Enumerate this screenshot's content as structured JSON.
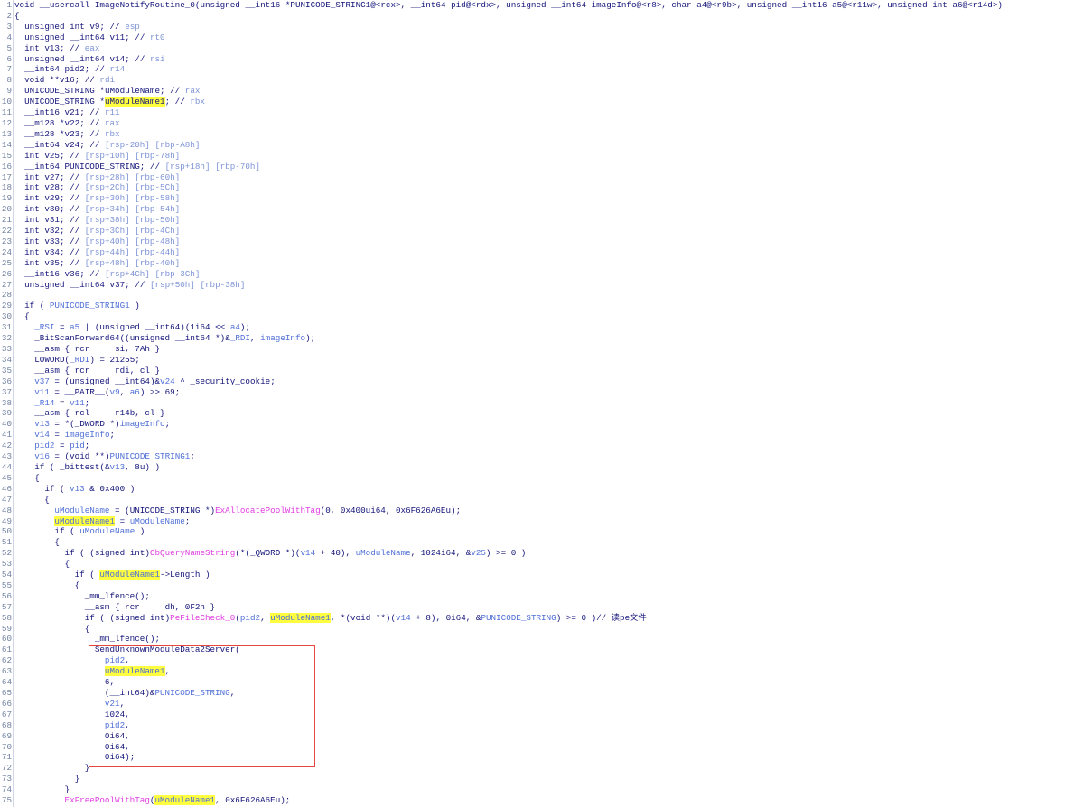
{
  "colors": {
    "background": "#ffffff",
    "code_text": "#14147a",
    "variable": "#4f6fd6",
    "api_function": "#e03ce0",
    "register_comment": "#7d93d6",
    "highlight": "#ffff40",
    "line_number": "#6f7f9f",
    "annotation_box": "#e5473d",
    "gutter_divider": "#cfd7e6"
  },
  "editor": {
    "highlighted_identifier": "uModuleName1",
    "lines": [
      {
        "n": 1,
        "text": "void __usercall ImageNotifyRoutine_0(unsigned __int16 *PUNICODE_STRING1@<rcx>, __int64 pid@<rdx>, unsigned __int64 imageInfo@<r8>, char a4@<r9b>, unsigned __int16 a5@<r11w>, unsigned int a6@<r14d>)"
      },
      {
        "n": 2,
        "text": "{"
      },
      {
        "n": 3,
        "text": "  unsigned int v9; // esp"
      },
      {
        "n": 4,
        "text": "  unsigned __int64 v11; // rt0"
      },
      {
        "n": 5,
        "text": "  int v13; // eax"
      },
      {
        "n": 6,
        "text": "  unsigned __int64 v14; // rsi"
      },
      {
        "n": 7,
        "text": "  __int64 pid2; // r14"
      },
      {
        "n": 8,
        "text": "  void **v16; // rdi"
      },
      {
        "n": 9,
        "text": "  UNICODE_STRING *uModuleName; // rax"
      },
      {
        "n": 10,
        "text": "  UNICODE_STRING *uModuleName1; // rbx"
      },
      {
        "n": 11,
        "text": "  __int16 v21; // r11"
      },
      {
        "n": 12,
        "text": "  __m128 *v22; // rax"
      },
      {
        "n": 13,
        "text": "  __m128 *v23; // rbx"
      },
      {
        "n": 14,
        "text": "  __int64 v24; // [rsp-20h] [rbp-A8h]"
      },
      {
        "n": 15,
        "text": "  int v25; // [rsp+10h] [rbp-78h]"
      },
      {
        "n": 16,
        "text": "  __int64 PUNICODE_STRING; // [rsp+18h] [rbp-70h]"
      },
      {
        "n": 17,
        "text": "  int v27; // [rsp+28h] [rbp-60h]"
      },
      {
        "n": 18,
        "text": "  int v28; // [rsp+2Ch] [rbp-5Ch]"
      },
      {
        "n": 19,
        "text": "  int v29; // [rsp+30h] [rbp-58h]"
      },
      {
        "n": 20,
        "text": "  int v30; // [rsp+34h] [rbp-54h]"
      },
      {
        "n": 21,
        "text": "  int v31; // [rsp+38h] [rbp-50h]"
      },
      {
        "n": 22,
        "text": "  int v32; // [rsp+3Ch] [rbp-4Ch]"
      },
      {
        "n": 23,
        "text": "  int v33; // [rsp+40h] [rbp-48h]"
      },
      {
        "n": 24,
        "text": "  int v34; // [rsp+44h] [rbp-44h]"
      },
      {
        "n": 25,
        "text": "  int v35; // [rsp+48h] [rbp-40h]"
      },
      {
        "n": 26,
        "text": "  __int16 v36; // [rsp+4Ch] [rbp-3Ch]"
      },
      {
        "n": 27,
        "text": "  unsigned __int64 v37; // [rsp+50h] [rbp-38h]"
      },
      {
        "n": 28,
        "text": ""
      },
      {
        "n": 29,
        "text": "  if ( PUNICODE_STRING1 )"
      },
      {
        "n": 30,
        "text": "  {"
      },
      {
        "n": 31,
        "text": "    _RSI = a5 | (unsigned __int64)(1i64 << a4);"
      },
      {
        "n": 32,
        "text": "    _BitScanForward64((unsigned __int64 *)&_RDI, imageInfo);"
      },
      {
        "n": 33,
        "text": "    __asm { rcr     si, 7Ah }"
      },
      {
        "n": 34,
        "text": "    LOWORD(_RDI) = 21255;"
      },
      {
        "n": 35,
        "text": "    __asm { rcr     rdi, cl }"
      },
      {
        "n": 36,
        "text": "    v37 = (unsigned __int64)&v24 ^ _security_cookie;"
      },
      {
        "n": 37,
        "text": "    v11 = __PAIR__(v9, a6) >> 69;"
      },
      {
        "n": 38,
        "text": "    _R14 = v11;"
      },
      {
        "n": 39,
        "text": "    __asm { rcl     r14b, cl }"
      },
      {
        "n": 40,
        "text": "    v13 = *(_DWORD *)imageInfo;"
      },
      {
        "n": 41,
        "text": "    v14 = imageInfo;"
      },
      {
        "n": 42,
        "text": "    pid2 = pid;"
      },
      {
        "n": 43,
        "text": "    v16 = (void **)PUNICODE_STRING1;"
      },
      {
        "n": 44,
        "text": "    if ( _bittest(&v13, 8u) )"
      },
      {
        "n": 45,
        "text": "    {"
      },
      {
        "n": 46,
        "text": "      if ( v13 & 0x400 )"
      },
      {
        "n": 47,
        "text": "      {"
      },
      {
        "n": 48,
        "text": "        uModuleName = (UNICODE_STRING *)ExAllocatePoolWithTag(0, 0x400ui64, 0x6F626A6Eu);"
      },
      {
        "n": 49,
        "text": "        uModuleName1 = uModuleName;"
      },
      {
        "n": 50,
        "text": "        if ( uModuleName )"
      },
      {
        "n": 51,
        "text": "        {"
      },
      {
        "n": 52,
        "text": "          if ( (signed int)ObQueryNameString(*(_QWORD *)(v14 + 40), uModuleName, 1024i64, &v25) >= 0 )"
      },
      {
        "n": 53,
        "text": "          {"
      },
      {
        "n": 54,
        "text": "            if ( uModuleName1->Length )"
      },
      {
        "n": 55,
        "text": "            {"
      },
      {
        "n": 56,
        "text": "              _mm_lfence();"
      },
      {
        "n": 57,
        "text": "              __asm { rcr     dh, 0F2h }"
      },
      {
        "n": 58,
        "text": "              if ( (signed int)PeFileCheck_0(pid2, uModuleName1, *(void **)(v14 + 8), 0i64, &PUNICODE_STRING) >= 0 )// 读pe文件"
      },
      {
        "n": 59,
        "text": "              {"
      },
      {
        "n": 60,
        "text": "                _mm_lfence();"
      },
      {
        "n": 61,
        "text": "                SendUnknownModuleData2Server("
      },
      {
        "n": 62,
        "text": "                  pid2,"
      },
      {
        "n": 63,
        "text": "                  uModuleName1,"
      },
      {
        "n": 64,
        "text": "                  6,"
      },
      {
        "n": 65,
        "text": "                  (__int64)&PUNICODE_STRING,"
      },
      {
        "n": 66,
        "text": "                  v21,"
      },
      {
        "n": 67,
        "text": "                  1024,"
      },
      {
        "n": 68,
        "text": "                  pid2,"
      },
      {
        "n": 69,
        "text": "                  0i64,"
      },
      {
        "n": 70,
        "text": "                  0i64,"
      },
      {
        "n": 71,
        "text": "                  0i64);"
      },
      {
        "n": 72,
        "text": "              }"
      },
      {
        "n": 73,
        "text": "            }"
      },
      {
        "n": 74,
        "text": "          }"
      },
      {
        "n": 75,
        "text": "          ExFreePoolWithTag(uModuleName1, 0x6F626A6Eu);"
      }
    ]
  }
}
